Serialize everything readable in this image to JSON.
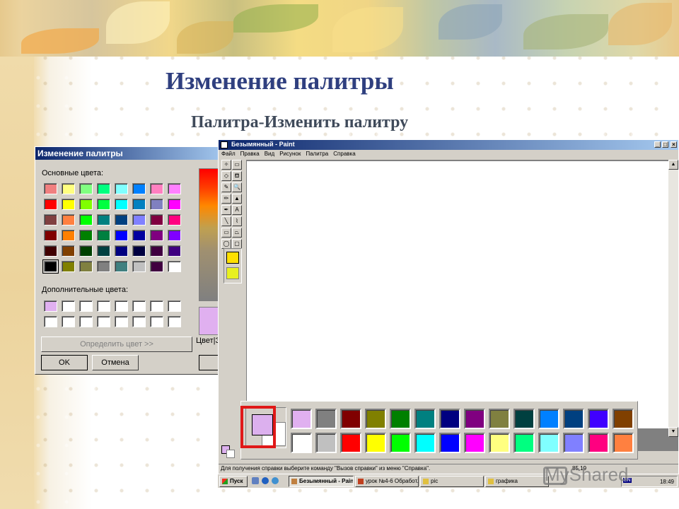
{
  "slide": {
    "title": "Изменение палитры",
    "subtitle": "Палитра-Изменить палитру"
  },
  "dialog": {
    "title": "Изменение палитры",
    "basic_colors_label": "Основные цвета:",
    "custom_colors_label": "Дополнительные цвета:",
    "define_button": "Определить цвет >>",
    "ok_button": "OK",
    "cancel_button": "Отмена",
    "color_label": "Цвет|З",
    "basic_colors": [
      "#f08080",
      "#ffff80",
      "#80ff80",
      "#00ff80",
      "#80ffff",
      "#0080ff",
      "#ff80c0",
      "#ff80ff",
      "#ff0000",
      "#ffff00",
      "#80ff00",
      "#00ff40",
      "#00ffff",
      "#0080c0",
      "#8080c0",
      "#ff00ff",
      "#804040",
      "#ff8040",
      "#00ff00",
      "#008080",
      "#004080",
      "#8080ff",
      "#800040",
      "#ff0080",
      "#800000",
      "#ff8000",
      "#008000",
      "#008040",
      "#0000ff",
      "#0000a0",
      "#800080",
      "#8000ff",
      "#400000",
      "#804000",
      "#004000",
      "#004040",
      "#000080",
      "#000040",
      "#400040",
      "#400080",
      "#000000",
      "#808000",
      "#808040",
      "#808080",
      "#408080",
      "#c0c0c0",
      "#400040",
      "#ffffff"
    ],
    "custom_colors": [
      "#e0b0f0",
      "#ffffff",
      "#ffffff",
      "#ffffff",
      "#ffffff",
      "#ffffff",
      "#ffffff",
      "#ffffff",
      "#ffffff",
      "#ffffff",
      "#ffffff",
      "#ffffff",
      "#ffffff",
      "#ffffff",
      "#ffffff",
      "#ffffff"
    ]
  },
  "paint": {
    "title": "Безымянный - Paint",
    "menu": [
      "Файл",
      "Правка",
      "Вид",
      "Рисунок",
      "Палитра",
      "Справка"
    ],
    "status_text": "Для получения справки выберите команду \"Вызов справки\" из меню \"Справка\".",
    "status_coords": "85,19",
    "tools": [
      "✧",
      "▭",
      "◇",
      "⛾",
      "✎",
      "🔍",
      "✏",
      "▲",
      "✒",
      "A",
      "╲",
      "⌇",
      "▭",
      "⏢",
      "◯",
      "▢"
    ]
  },
  "palette": {
    "foreground": "#dcb0ee",
    "background": "#ffffff",
    "top_row": [
      "#e0b0f0",
      "#808080",
      "#800000",
      "#808000",
      "#008000",
      "#008080",
      "#000080",
      "#800080",
      "#808040",
      "#004040",
      "#0080ff",
      "#004080",
      "#4000ff",
      "#804000"
    ],
    "bottom_row": [
      "#ffffff",
      "#c0c0c0",
      "#ff0000",
      "#ffff00",
      "#00ff00",
      "#00ffff",
      "#0000ff",
      "#ff00ff",
      "#ffff80",
      "#00ff80",
      "#80ffff",
      "#8080ff",
      "#ff0080",
      "#ff8040"
    ]
  },
  "taskbar": {
    "start": "Пуск",
    "buttons": [
      "Безымянный - Paint",
      "урок №4-6 Обработ...",
      "pic",
      "графика"
    ],
    "lang": "EN",
    "clock": "18:49"
  },
  "watermark": "MyShared"
}
